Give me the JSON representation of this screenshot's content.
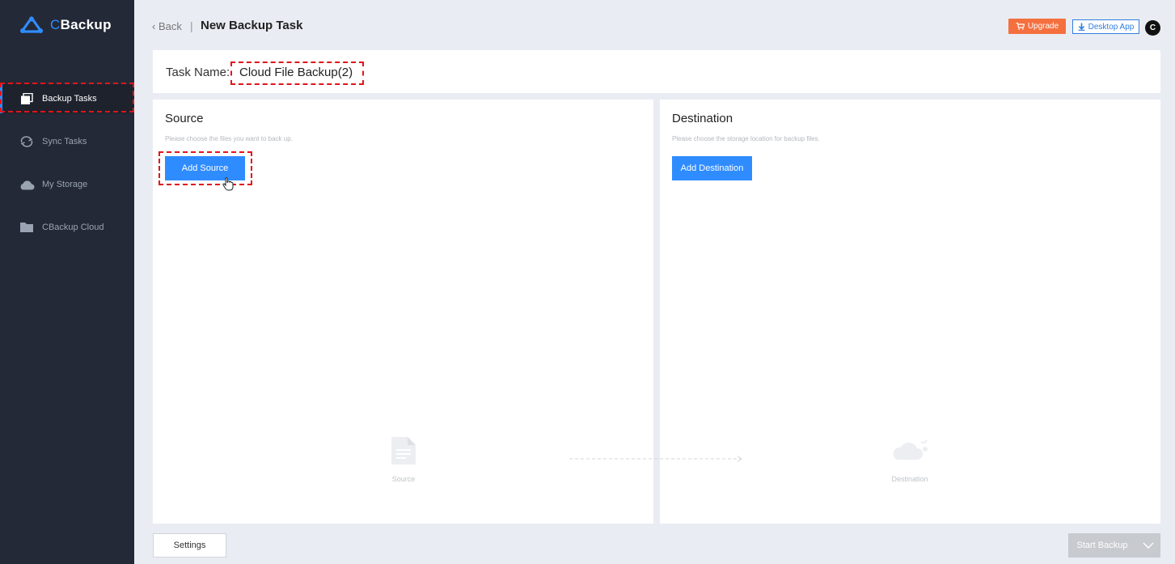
{
  "app": {
    "logo_c": "C",
    "logo_rest": "Backup"
  },
  "sidebar": {
    "items": [
      {
        "label": "Backup Tasks",
        "icon": "backup-tasks-icon",
        "active": true
      },
      {
        "label": "Sync Tasks",
        "icon": "sync-icon",
        "active": false
      },
      {
        "label": "My Storage",
        "icon": "cloud-icon",
        "active": false
      },
      {
        "label": "CBackup Cloud",
        "icon": "folder-icon",
        "active": false
      }
    ]
  },
  "header": {
    "back_label": "Back",
    "separator": "|",
    "title": "New Backup Task",
    "upgrade_label": "Upgrade",
    "desktop_label": "Desktop App",
    "avatar_letter": "C"
  },
  "task": {
    "name_label": "Task Name:",
    "name_value": "Cloud File Backup(2)"
  },
  "source": {
    "title": "Source",
    "hint": "Please choose the files you want to back up.",
    "button_label": "Add Source",
    "illustration_label": "Source"
  },
  "destination": {
    "title": "Destination",
    "hint": "Please choose the storage location for backup files.",
    "button_label": "Add Destination",
    "illustration_label": "Destination"
  },
  "footer": {
    "settings_label": "Settings",
    "start_label": "Start Backup"
  },
  "colors": {
    "accent": "#2f8cff",
    "sidebar_bg": "#232936",
    "upgrade": "#f4703f",
    "highlight": "#e0151b"
  }
}
